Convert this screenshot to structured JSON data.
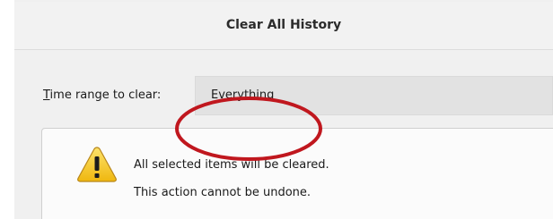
{
  "dialog": {
    "title": "Clear All History"
  },
  "time_range": {
    "label_mnemonic": "T",
    "label_rest": "ime range to clear:",
    "selected_value": "Everything"
  },
  "warning": {
    "icon": "warning-triangle-icon",
    "line1": "All selected items will be cleared.",
    "line2": "This action cannot be undone."
  },
  "annotation": {
    "shape": "ellipse",
    "color": "#c0171e"
  },
  "colors": {
    "dialog_bg": "#f0f0f0",
    "select_bg": "#e2e2e2",
    "warning_yellow": "#f3c615",
    "annotation_red": "#c0171e"
  }
}
